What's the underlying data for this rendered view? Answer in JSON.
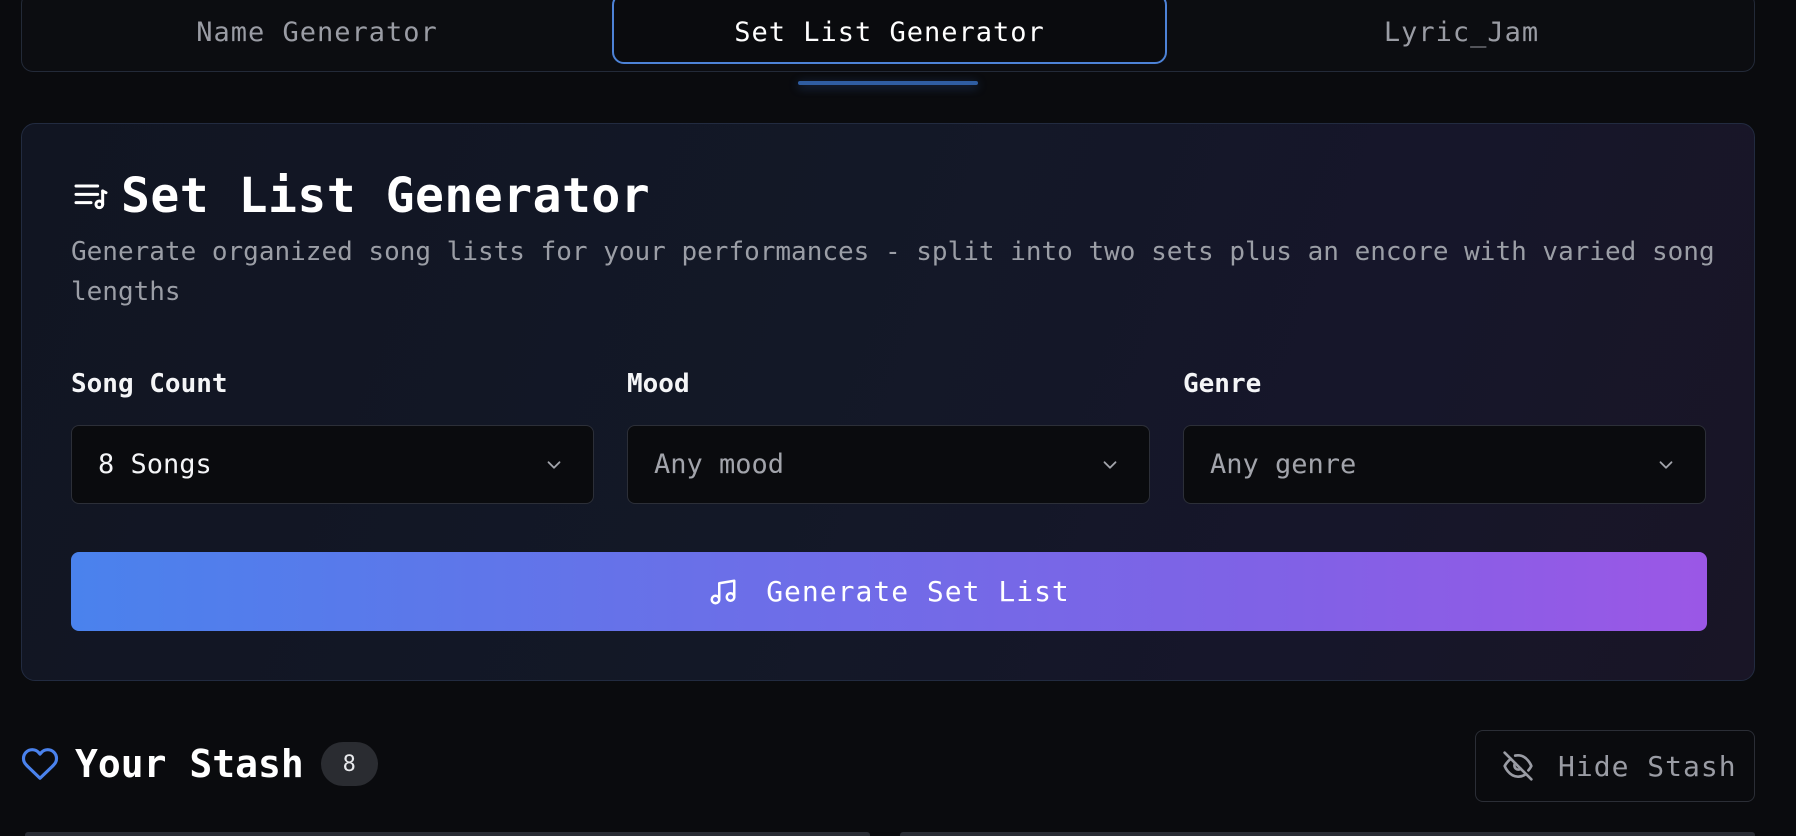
{
  "tabs": [
    {
      "label": "Name Generator"
    },
    {
      "label": "Set List Generator"
    },
    {
      "label": "Lyric_Jam"
    }
  ],
  "active_tab": "Set List Generator",
  "card": {
    "title": "Set List Generator",
    "description": "Generate organized song lists for your performances - split into two sets plus an encore with varied song lengths",
    "icon": "music-list-icon"
  },
  "fields": {
    "song_count": {
      "label": "Song Count",
      "value": "8 Songs"
    },
    "mood": {
      "label": "Mood",
      "value": "Any mood"
    },
    "genre": {
      "label": "Genre",
      "value": "Any genre"
    }
  },
  "generate_button": {
    "label": "Generate Set List",
    "icon": "music-note-icon"
  },
  "stash": {
    "title": "Your Stash",
    "count": "8",
    "icon": "heart-icon",
    "hide_label": "Hide Stash",
    "hide_icon": "eye-off-icon"
  },
  "colors": {
    "accent_blue": "#4a82ed",
    "accent_purple": "#9b57e6",
    "background": "#0a0b0e"
  }
}
